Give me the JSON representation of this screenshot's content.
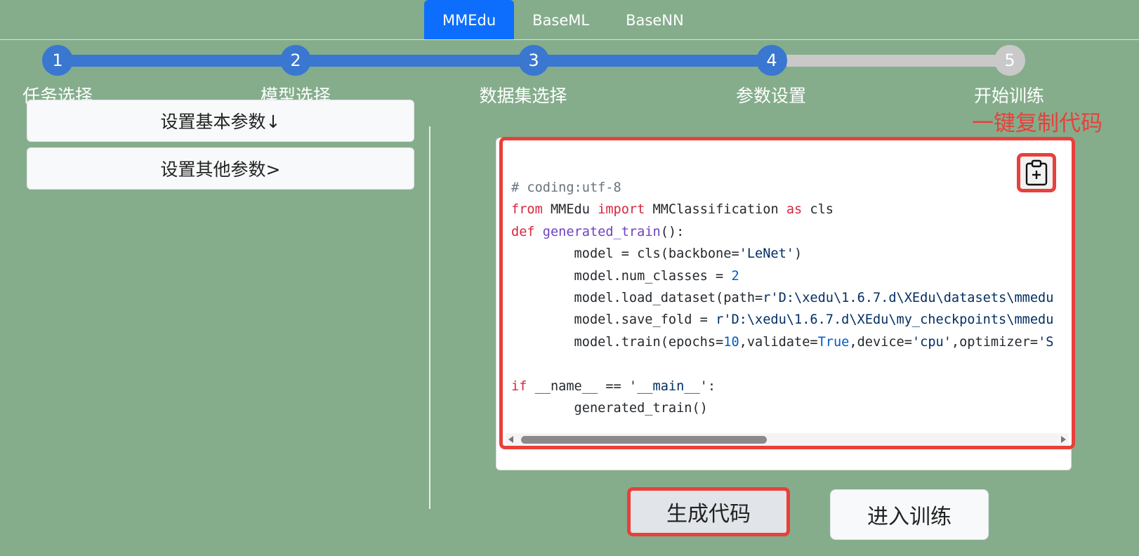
{
  "tabs": [
    {
      "label": "MMEdu",
      "active": true
    },
    {
      "label": "BaseML",
      "active": false
    },
    {
      "label": "BaseNN",
      "active": false
    }
  ],
  "steps": [
    {
      "number": "1",
      "label": "任务选择",
      "state": "done"
    },
    {
      "number": "2",
      "label": "模型选择",
      "state": "done"
    },
    {
      "number": "3",
      "label": "数据集选择",
      "state": "done"
    },
    {
      "number": "4",
      "label": "参数设置",
      "state": "current"
    },
    {
      "number": "5",
      "label": "开始训练",
      "state": "todo"
    }
  ],
  "sidebar": {
    "basic_params_label": "设置基本参数↓",
    "other_params_label": "设置其他参数>"
  },
  "annotation": {
    "copy_note": "一键复制代码"
  },
  "code": {
    "lines": [
      [
        {
          "t": "# coding:utf-8",
          "c": "cm"
        }
      ],
      [
        {
          "t": "from",
          "c": "kw"
        },
        {
          "t": " MMEdu ",
          "c": ""
        },
        {
          "t": "import",
          "c": "kw"
        },
        {
          "t": " MMClassification ",
          "c": ""
        },
        {
          "t": "as",
          "c": "kw"
        },
        {
          "t": " cls",
          "c": ""
        }
      ],
      [
        {
          "t": "def",
          "c": "kw"
        },
        {
          "t": " ",
          "c": ""
        },
        {
          "t": "generated_train",
          "c": "fn"
        },
        {
          "t": "():",
          "c": ""
        }
      ],
      [
        {
          "t": "        model = cls(backbone=",
          "c": ""
        },
        {
          "t": "'LeNet'",
          "c": "str"
        },
        {
          "t": ")",
          "c": ""
        }
      ],
      [
        {
          "t": "        model.num_classes = ",
          "c": ""
        },
        {
          "t": "2",
          "c": "num"
        }
      ],
      [
        {
          "t": "        model.load_dataset(path=",
          "c": ""
        },
        {
          "t": "r'D:\\xedu\\1.6.7.d\\XEdu\\datasets\\mmedu",
          "c": "str"
        }
      ],
      [
        {
          "t": "        model.save_fold = ",
          "c": ""
        },
        {
          "t": "r'D:\\xedu\\1.6.7.d\\XEdu\\my_checkpoints\\mmedu",
          "c": "str"
        }
      ],
      [
        {
          "t": "        model.train(epochs=",
          "c": ""
        },
        {
          "t": "10",
          "c": "num"
        },
        {
          "t": ",validate=",
          "c": ""
        },
        {
          "t": "True",
          "c": "num"
        },
        {
          "t": ",device=",
          "c": ""
        },
        {
          "t": "'cpu'",
          "c": "str"
        },
        {
          "t": ",optimizer=",
          "c": ""
        },
        {
          "t": "'S",
          "c": "str"
        }
      ],
      [
        {
          "t": "",
          "c": ""
        }
      ],
      [
        {
          "t": "if",
          "c": "kw"
        },
        {
          "t": " __name__ == ",
          "c": ""
        },
        {
          "t": "'__main__'",
          "c": "str"
        },
        {
          "t": ":",
          "c": ""
        }
      ],
      [
        {
          "t": "        generated_train()",
          "c": ""
        }
      ]
    ]
  },
  "actions": {
    "generate_label": "生成代码",
    "train_label": "进入训练"
  },
  "colors": {
    "background": "#85ad8c",
    "accent": "#0d6efd",
    "step_done": "#3a77d0",
    "step_todo": "#c9c9c9",
    "highlight": "#e8403b"
  },
  "icons": {
    "copy": "clipboard-plus-icon"
  }
}
